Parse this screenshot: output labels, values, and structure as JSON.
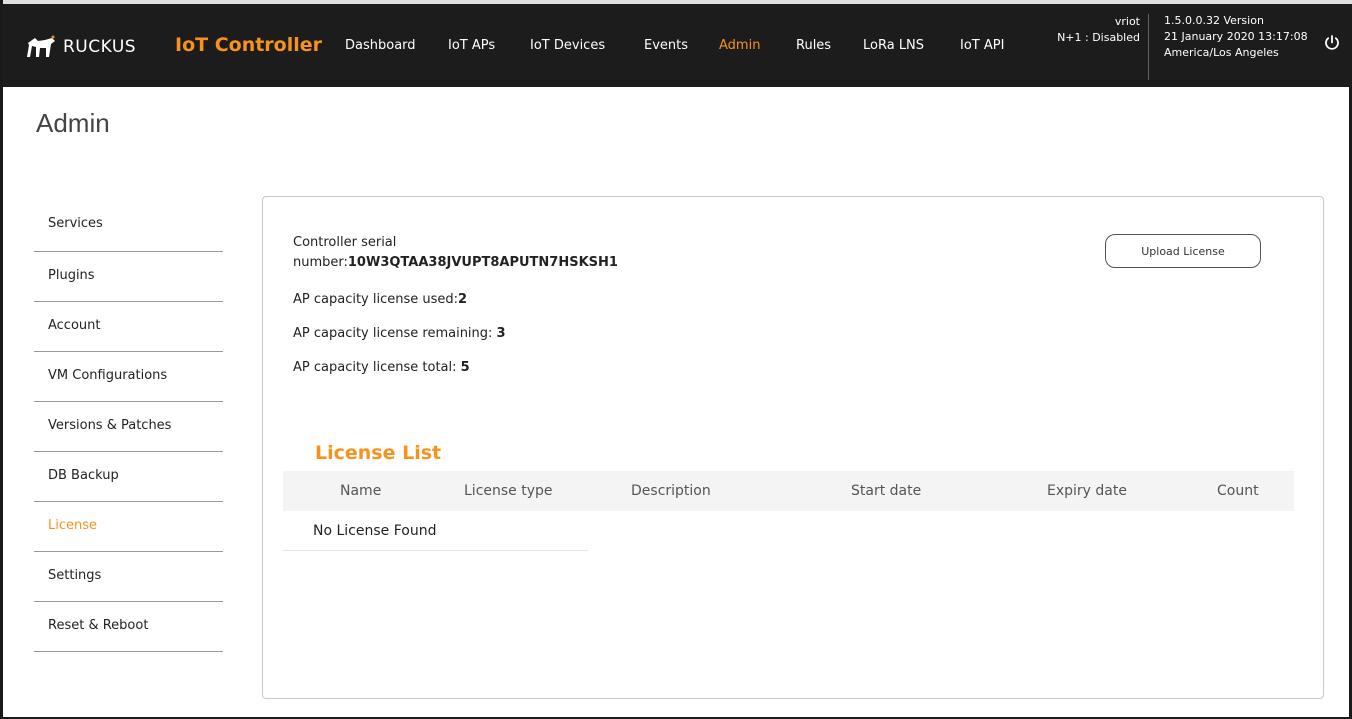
{
  "header": {
    "brand": "RUCKUS",
    "app_title": "IoT Controller",
    "nav": [
      {
        "label": "Dashboard",
        "active": false
      },
      {
        "label": "IoT APs",
        "active": false
      },
      {
        "label": "IoT Devices",
        "active": false
      },
      {
        "label": "Events",
        "active": false
      },
      {
        "label": "Admin",
        "active": true
      },
      {
        "label": "Rules",
        "active": false
      },
      {
        "label": "LoRa LNS",
        "active": false
      },
      {
        "label": "IoT API",
        "active": false
      }
    ],
    "cluster_name": "vriot",
    "cluster_status": "N+1 : Disabled",
    "version": "1.5.0.0.32 Version",
    "datetime": "21 January 2020 13:17:08",
    "timezone": "America/Los Angeles",
    "power_icon": "power-icon",
    "accent_color": "#f7931d"
  },
  "page": {
    "title": "Admin"
  },
  "sidebar": {
    "items": [
      {
        "label": "Services"
      },
      {
        "label": "Plugins"
      },
      {
        "label": "Account"
      },
      {
        "label": "VM Configurations"
      },
      {
        "label": "Versions & Patches"
      },
      {
        "label": "DB Backup"
      },
      {
        "label": "License",
        "active": true
      },
      {
        "label": "Settings"
      },
      {
        "label": "Reset & Reboot"
      }
    ]
  },
  "license": {
    "serial_label_1": "Controller serial",
    "serial_label_2": "number:",
    "serial_value": "10W3QTAA38JVUPT8APUTN7HSKSH1",
    "used_label": "AP capacity license used:",
    "used_value": "2",
    "remaining_label": "AP capacity license remaining: ",
    "remaining_value": "3",
    "total_label": "AP capacity license total: ",
    "total_value": "5",
    "upload_button": "Upload License",
    "list_title": "License List",
    "columns": [
      "Name",
      "License type",
      "Description",
      "Start date",
      "Expiry date",
      "Count"
    ],
    "empty_text": "No License Found"
  }
}
